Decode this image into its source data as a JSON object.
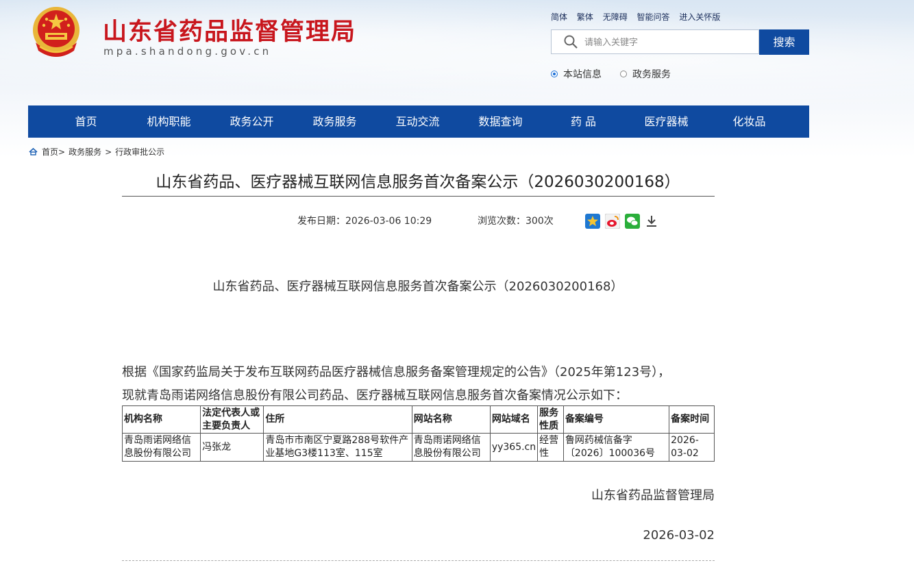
{
  "header": {
    "site_title": "山东省药品监督管理局",
    "site_domain": "mpa.shandong.gov.cn",
    "toplinks": [
      "简体",
      "繁体",
      "无障碍",
      "智能问答",
      "进入关怀版"
    ],
    "search": {
      "placeholder": "请输入关键字",
      "button": "搜索"
    },
    "scope": [
      {
        "label": "本站信息",
        "checked": true
      },
      {
        "label": "政务服务",
        "checked": false
      }
    ]
  },
  "nav": [
    "首页",
    "机构职能",
    "政务公开",
    "政务服务",
    "互动交流",
    "数据查询",
    "药 品",
    "医疗器械",
    "化妆品"
  ],
  "breadcrumb": {
    "home": "首页",
    "sep1": ">",
    "item1": "政务服务",
    "sep2": ">",
    "item2": "行政审批公示"
  },
  "article": {
    "title": "山东省药品、医疗器械互联网信息服务首次备案公示（2026030200168）",
    "publish_date": "发布日期：2026-03-06 10:29",
    "views": "浏览次数：300次",
    "share_icons": [
      "favorite-icon",
      "weibo-icon",
      "wechat-icon",
      "download-icon"
    ],
    "body_title": "山东省药品、医疗器械互联网信息服务首次备案公示（2026030200168）",
    "para1": "根据《国家药监局关于发布互联网药品医疗器械信息服务备案管理规定的公告》（2025年第123号），",
    "para2": "现就青岛雨诺网络信息股份有限公司药品、医疗器械互联网信息服务首次备案情况公示如下：",
    "table": {
      "headers": [
        "机构名称",
        "法定代表人或主要负责人",
        "住所",
        "网站名称",
        "网站域名",
        "服务性质",
        "备案编号",
        "备案时间"
      ],
      "rows": [
        [
          "青岛雨诺网络信息股份有限公司",
          "冯张龙",
          "青岛市市南区宁夏路288号软件产业基地G3楼113室、115室",
          "青岛雨诺网络信息股份有限公司",
          "yy365.cn",
          "经营性",
          "鲁网药械信备字〔2026〕100036号",
          "2026-03-02"
        ]
      ]
    },
    "signature": "山东省药品监督管理局",
    "sign_date": "2026-03-02"
  },
  "colors": {
    "brand_red": "#c8161d",
    "nav_blue": "#0f4aa0"
  }
}
